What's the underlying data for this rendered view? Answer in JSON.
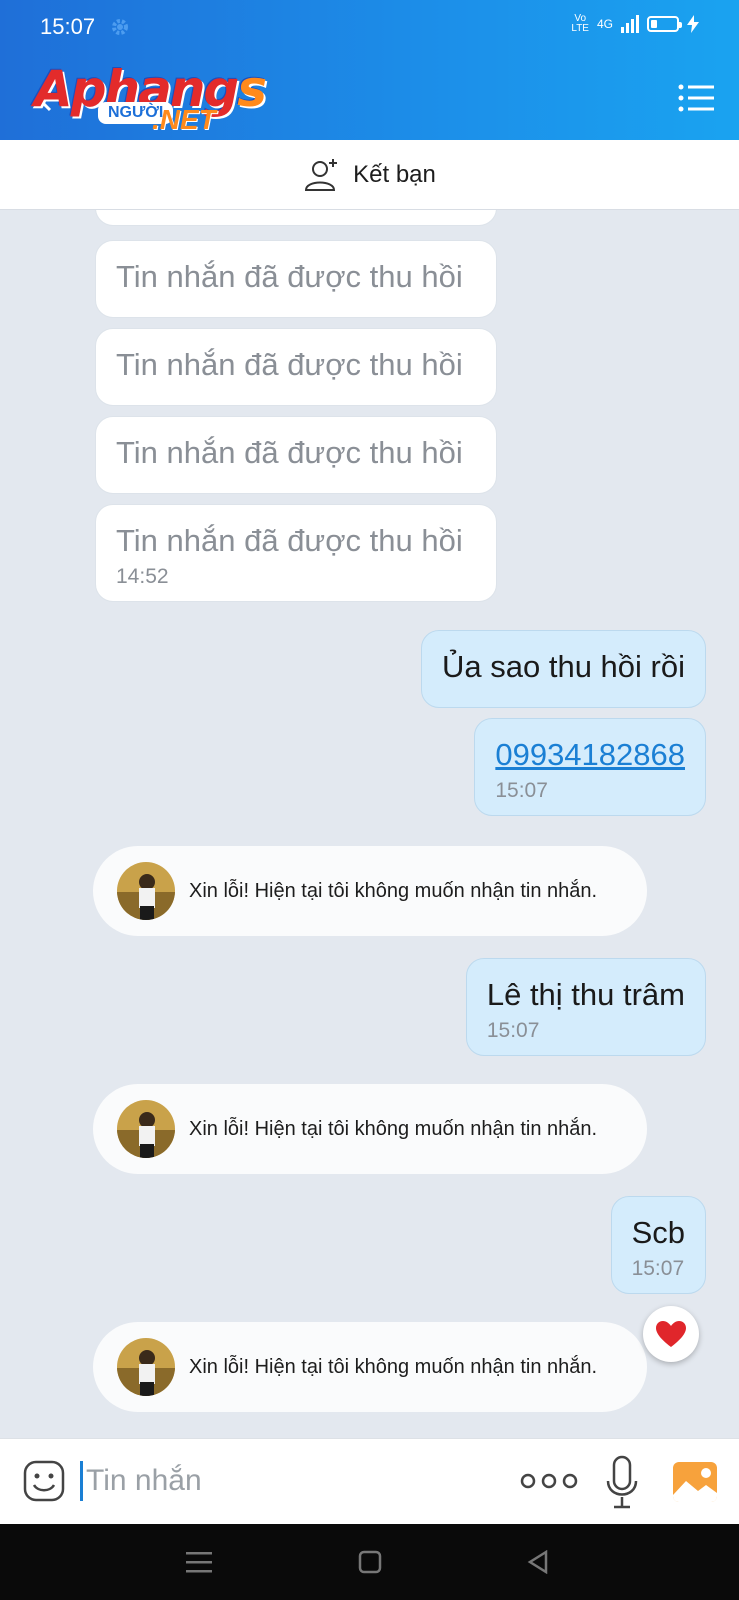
{
  "status_bar": {
    "time": "15:07",
    "network_top": "Vo",
    "network_bottom": "LTE",
    "net_type": "4G"
  },
  "header": {
    "logo_main": "Aphang",
    "logo_s": "s",
    "logo_badge": "NGƯỜI",
    "logo_net": ".NET"
  },
  "friend_bar": {
    "label": "Kết bạn"
  },
  "messages": {
    "recalled_text": "Tin nhắn đã được thu hồi",
    "recalled_time": "14:52",
    "out1_text": "Ủa sao thu hồi rồi",
    "out2_link": "09934182868",
    "out2_time": "15:07",
    "auto_reply": "Xin lỗi! Hiện tại tôi không muốn nhận tin nhắn.",
    "out3_text": "Lê thị thu trâm",
    "out3_time": "15:07",
    "out4_text": "Scb",
    "out4_time": "15:07"
  },
  "input": {
    "placeholder": "Tin nhắn"
  },
  "colors": {
    "header_start": "#1f6fd8",
    "header_end": "#1aa3f0",
    "out_bubble": "#d4ecfc",
    "link": "#1a7fd4",
    "heart": "#e0262b"
  },
  "icons": [
    "settings-gear-icon",
    "back-arrow-icon",
    "menu-list-icon",
    "add-friend-icon",
    "avatar-photo",
    "heart-icon",
    "emoji-icon",
    "more-dots-icon",
    "microphone-icon",
    "image-icon"
  ]
}
